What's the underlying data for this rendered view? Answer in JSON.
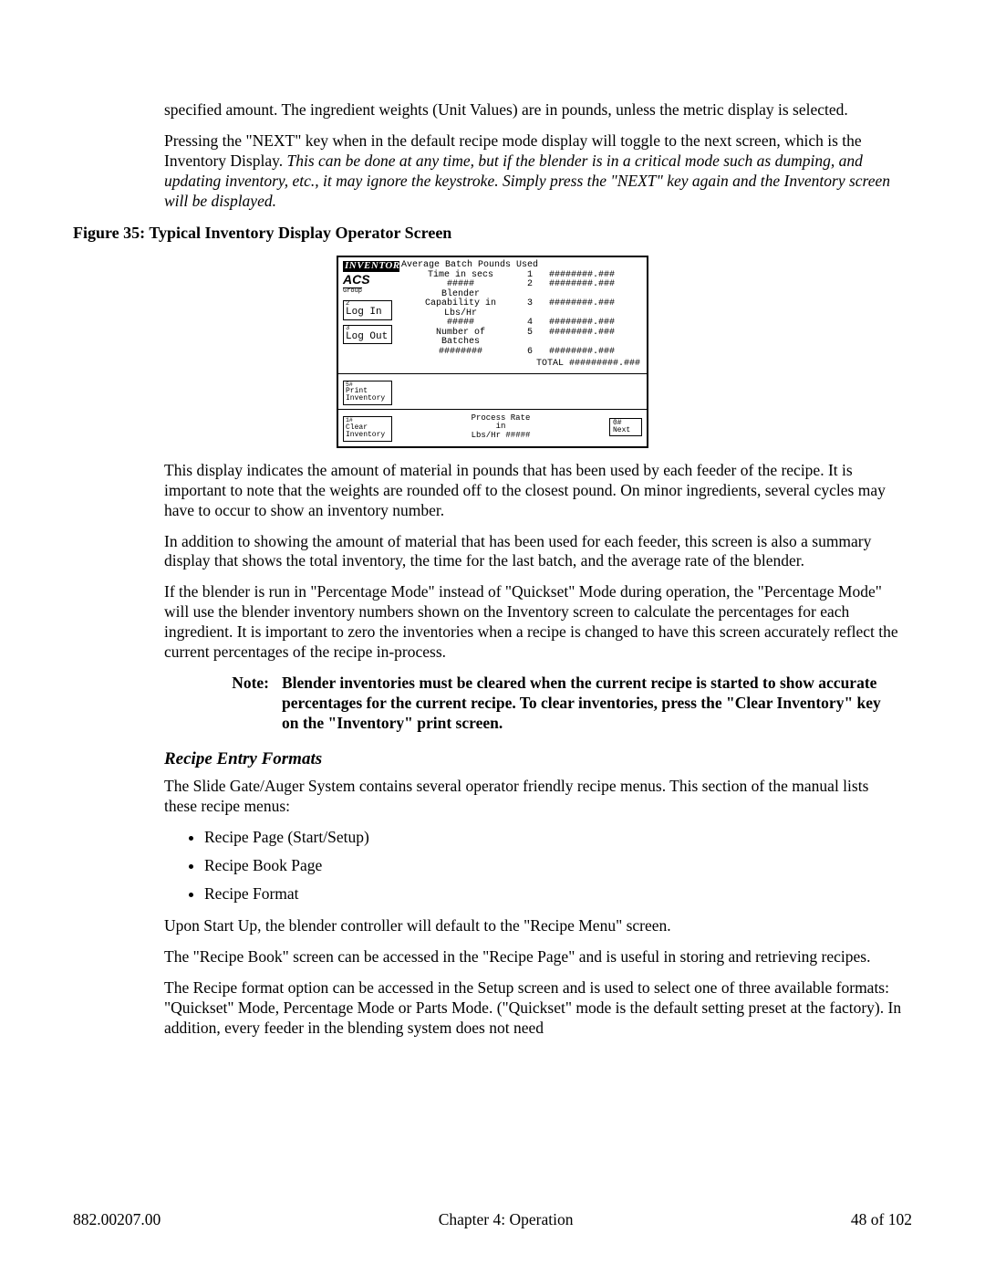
{
  "intro": {
    "p1": "specified amount. The ingredient weights (Unit Values) are in pounds, unless the metric display is selected.",
    "p2a": "Pressing the \"NEXT\" key when in the default recipe mode display will toggle to the next screen, which is the Inventory Display. ",
    "p2b": "This can be done at any time, but if the blender is in a critical mode such as dumping, and updating inventory, etc., it may ignore the keystroke. Simply press the \"NEXT\" key again and the Inventory screen will be displayed."
  },
  "figure_caption": "Figure 35: Typical Inventory Display Operator Screen",
  "display": {
    "title": "INVENTORY",
    "acs_logo": "ACS",
    "acs_sub": "Group",
    "button_login_sup": "2",
    "button_login": "Log In",
    "button_logout_sup": "3",
    "button_logout": "Log Out",
    "button_print_sup": "5#",
    "button_print_l1": "Print",
    "button_print_l2": "Inventory",
    "button_clear_sup": "1#",
    "button_clear_l1": "Clear",
    "button_clear_l2": "Inventory",
    "header_line": "Average Batch Pounds Used",
    "avg_label": "Time in secs",
    "avg_value": "#####",
    "cap_label1": "Blender",
    "cap_label2": "Capability in",
    "cap_label3": "Lbs/Hr",
    "cap_value": "#####",
    "num_label1": "Number of",
    "num_label2": "Batches",
    "num_value": "########",
    "rows": [
      {
        "n": "1",
        "v": "########.###"
      },
      {
        "n": "2",
        "v": "########.###"
      },
      {
        "n": "3",
        "v": "########.###"
      },
      {
        "n": "4",
        "v": "########.###"
      },
      {
        "n": "5",
        "v": "########.###"
      },
      {
        "n": "6",
        "v": "########.###"
      }
    ],
    "total_label": "TOTAL",
    "total_value": "#########.###",
    "process_label1": "Process Rate",
    "process_label2": "in",
    "process_label3": "Lbs/Hr",
    "process_value": "#####",
    "next_sup": "0#",
    "next_label": "Next"
  },
  "after_fig": {
    "p1": "This display indicates the amount of material in pounds that has been used by each feeder of the recipe. It is important to note that the weights are rounded off to the closest pound. On minor ingredients, several cycles may have to occur to show an inventory number.",
    "p2": "In addition to showing the amount of material that has been used for each feeder, this screen is also a summary display that shows the total inventory, the time for the last batch, and the average rate of the blender.",
    "p3": "If the blender is run in \"Percentage Mode\" instead of \"Quickset\" Mode during operation, the \"Percentage Mode\" will use the blender inventory numbers shown on the Inventory screen to calculate the percentages for each ingredient.  It is important to zero the inventories when a recipe is changed to have this screen accurately reflect the current percentages of the recipe in-process."
  },
  "note": {
    "label": "Note:",
    "body": "Blender inventories must be cleared when the current recipe is started to show accurate percentages for the current recipe.  To clear inventories, press the \"Clear Inventory\" key on the \"Inventory\" print screen."
  },
  "section_heading": "Recipe Entry Formats",
  "recipe_intro": "The Slide Gate/Auger System contains several operator friendly recipe menus. This section of the manual lists these recipe menus:",
  "bullets": [
    "Recipe Page (Start/Setup)",
    "Recipe Book Page",
    "Recipe Format"
  ],
  "tail": {
    "p1": "Upon Start Up, the blender controller will default to the \"Recipe Menu\" screen.",
    "p2": "The \"Recipe Book\" screen can be accessed in the \"Recipe Page\" and is useful in storing and retrieving recipes.",
    "p3": "The Recipe format option can be accessed in the Setup screen and is used to select one of three available formats: \"Quickset\" Mode, Percentage Mode or Parts Mode. (\"Quickset\" mode is the default setting preset at the factory).  In addition, every feeder in the blending system does not need"
  },
  "footer": {
    "left": "882.00207.00",
    "center": "Chapter 4: Operation",
    "right": "48 of 102"
  }
}
